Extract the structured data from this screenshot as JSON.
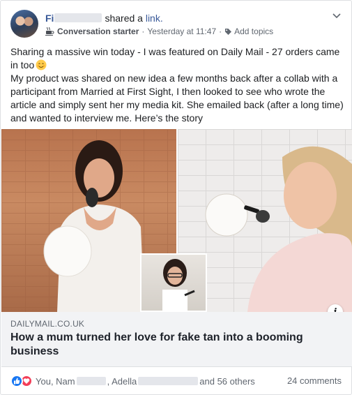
{
  "post": {
    "author_visible": "Fi",
    "shared_text": "shared a",
    "shared_link": "link.",
    "group_badge": "Conversation starter",
    "timestamp": "Yesterday at 11:47",
    "add_topics": "Add topics",
    "body": [
      "Sharing a massive win today - I was featured on Daily Mail - 27 orders came in too",
      "My product was shared on new idea a few months back after a collab with a participant from Married at First Sight, I then looked to see who wrote the article and simply sent her my media kit. She emailed back (after a long time) and wanted to interview me. Here’s the story"
    ]
  },
  "link_preview": {
    "domain": "DAILYMAIL.CO.UK",
    "headline": "How a mum turned her love for fake tan into a booming business"
  },
  "reactions": {
    "names_prefix": "You, Nam",
    "name_2": ", Adella",
    "suffix": "and 56 others",
    "comments": "24 comments"
  },
  "colors": {
    "link_blue": "#385898",
    "like_blue": "#1877f2",
    "love_red": "#f33e58",
    "meta_gray": "#606770"
  }
}
